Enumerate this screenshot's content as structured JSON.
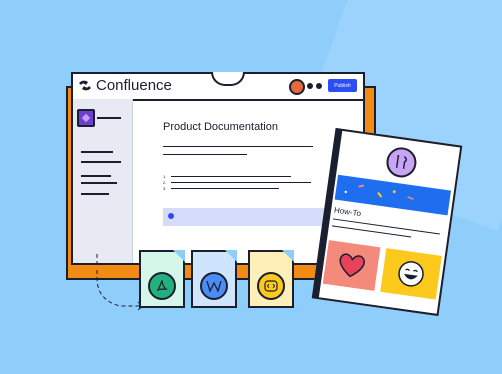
{
  "app": {
    "name": "Confluence",
    "publish_label": "Publish"
  },
  "document": {
    "title": "Product Documentation",
    "list_numbers": [
      "1.",
      "2.",
      "3."
    ]
  },
  "howto_card": {
    "label": "How-To"
  },
  "colors": {
    "background": "#8fcdfb",
    "window_shadow": "#f28b14",
    "publish_button": "#2d4cf6",
    "sidebar": "#e8eaf3",
    "howto_blue": "#1f6ef0",
    "heart_panel": "#f48a7c",
    "smile_panel": "#fbca1c",
    "pdf_card": "#d4f7ea",
    "word_card": "#cfe4fd",
    "code_card": "#fdefb7"
  },
  "file_cards": [
    {
      "icon": "pdf-icon"
    },
    {
      "icon": "word-icon"
    },
    {
      "icon": "code-icon"
    }
  ]
}
